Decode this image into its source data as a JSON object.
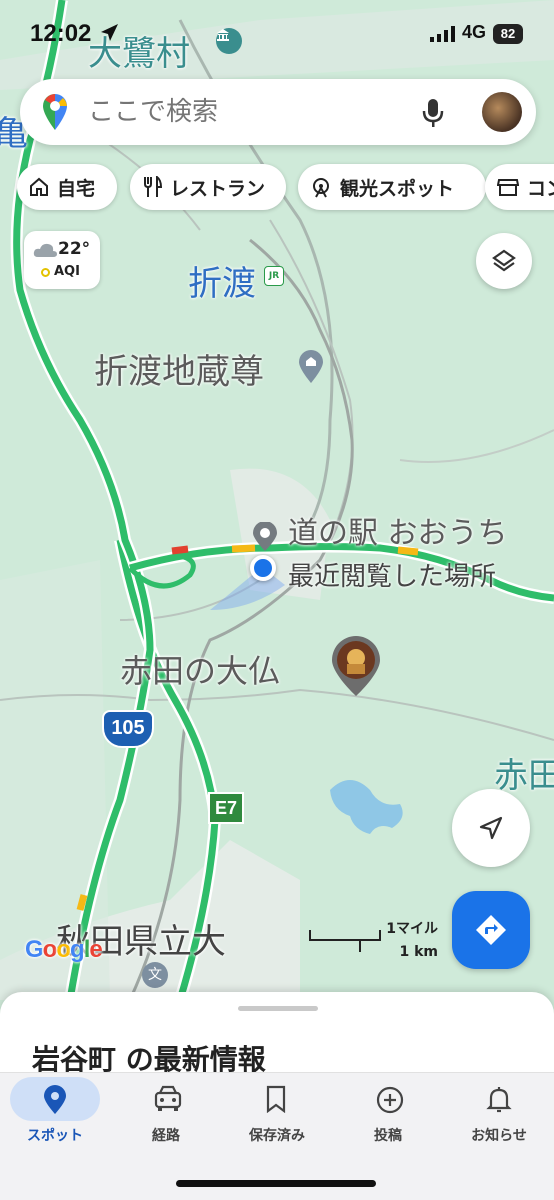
{
  "status_bar": {
    "time": "12:02",
    "network": "4G",
    "battery": "82"
  },
  "search": {
    "placeholder": "ここで検索"
  },
  "chips": [
    {
      "label": "自宅",
      "icon": "home-icon"
    },
    {
      "label": "レストラン",
      "icon": "restaurant-icon"
    },
    {
      "label": "観光スポット",
      "icon": "attraction-icon"
    },
    {
      "label": "コン",
      "icon": "store-icon"
    }
  ],
  "weather": {
    "temp": "22°",
    "aqi_label": "AQI"
  },
  "map": {
    "labels": {
      "osagi": "大鷺村",
      "kame": "亀",
      "orito": "折渡",
      "jizo": "折渡地蔵尊",
      "michinoeki": "道の駅 おおうち",
      "recent": "最近閲覧した場所",
      "daibutsu": "赤田の大仏",
      "akata": "赤田",
      "kenritsu": "秋田県立大",
      "route105": "105",
      "e7": "E7",
      "jr": "JR",
      "bun": "文"
    },
    "scale": {
      "mile": "1マイル",
      "km": "1 km"
    },
    "google": "Google"
  },
  "sheet": {
    "title": "岩谷町 の最新情報"
  },
  "tabs": [
    {
      "label": "スポット",
      "icon": "pin-icon",
      "active": true
    },
    {
      "label": "経路",
      "icon": "car-icon",
      "active": false
    },
    {
      "label": "保存済み",
      "icon": "bookmark-icon",
      "active": false
    },
    {
      "label": "投稿",
      "icon": "plus-circle-icon",
      "active": false
    },
    {
      "label": "お知らせ",
      "icon": "bell-icon",
      "active": false
    }
  ],
  "colors": {
    "accent": "#1a73e8",
    "road_green": "#2fbd6a",
    "map_bg": "#cfead9"
  }
}
